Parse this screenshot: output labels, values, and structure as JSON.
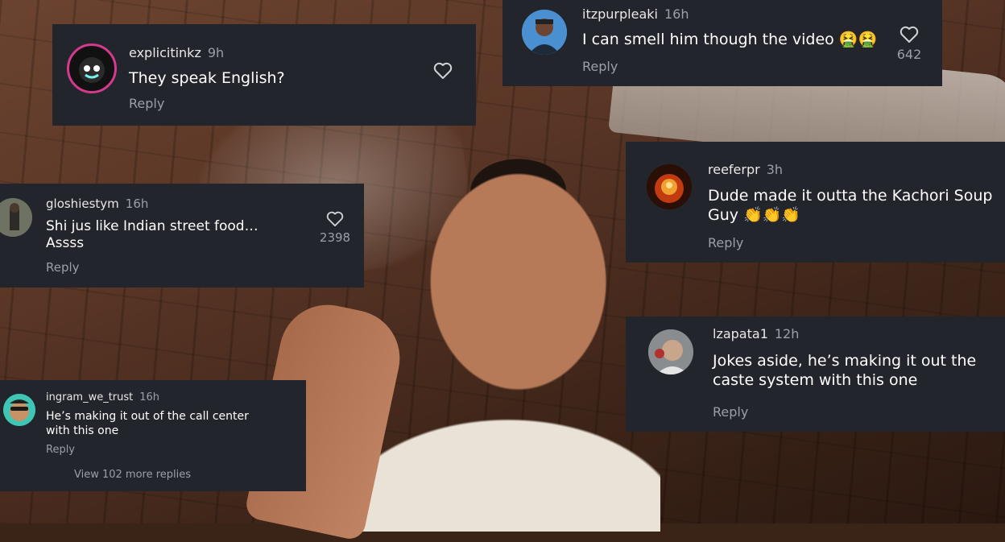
{
  "comments": [
    {
      "username": "explicitinkz",
      "time": "9h",
      "text": "They speak English?",
      "reply": "Reply"
    },
    {
      "username": "itzpurpleaki",
      "time": "16h",
      "text": "I can smell him though the video 🤮🤮",
      "reply": "Reply",
      "likes": "642"
    },
    {
      "username": "gloshiestym",
      "time": "16h",
      "text": "Shi jus like Indian street food… Assss",
      "reply": "Reply",
      "likes": "2398"
    },
    {
      "username": "reeferpr",
      "time": "3h",
      "text": "Dude made it outta the Kachori Soup Guy 👏👏👏",
      "reply": "Reply"
    },
    {
      "username": "lzapata1",
      "time": "12h",
      "text": "Jokes aside, he’s making it out the caste system with this one",
      "reply": "Reply"
    },
    {
      "username": "ingram_we_trust",
      "time": "16h",
      "text": "He’s making it out of the call center with this one",
      "reply": "Reply",
      "view_more": "View 102 more replies"
    }
  ],
  "icons": {
    "like": "heart-icon"
  },
  "colors": {
    "card_bg": "#22252b",
    "meta": "#9aa0a6",
    "text": "#ffffff"
  }
}
